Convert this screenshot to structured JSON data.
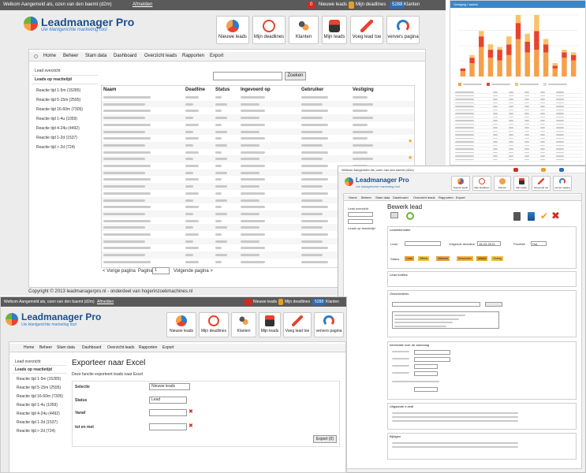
{
  "app": {
    "name": "Leadmanager Pro",
    "tagline": "Uw klantgerichte marketing tool"
  },
  "topbar": {
    "welcome": "Welkom Aangemeld als, ozen van den baemt (d2m)",
    "logout": "Afmelden",
    "new_leads_badge": "0",
    "new_leads": "Nieuwe leads",
    "my_deadlines": "Mijn deadlines",
    "clients_badge": "5288",
    "clients": "Klanten"
  },
  "toolbar": {
    "buttons": [
      {
        "label": "Nieuwe leads",
        "icon": "new-leads-icon"
      },
      {
        "label": "Mijn deadlines",
        "icon": "deadlines-clock-icon"
      },
      {
        "label": "Klanten",
        "icon": "clients-icon"
      },
      {
        "label": "Mijn leads",
        "icon": "my-leads-icon"
      },
      {
        "label": "Voeg lead toe",
        "icon": "add-lead-icon"
      },
      {
        "label": "ververs pagina",
        "icon": "refresh-icon"
      }
    ]
  },
  "tabs": [
    "Home",
    "Beheer",
    "Stam data",
    "Dashboard",
    "Overzicht leads",
    "Rapporten",
    "Export"
  ],
  "sidebar": {
    "overview": "Lead overzicht",
    "by_reaction": "Leads op reactietijd",
    "items": [
      "Reactie tijd 1-5m (15285)",
      "Reactie tijd 5-15m (2595)",
      "Reactie tijd 16-60m (7305)",
      "Reactie tijd 1-4u (1059)",
      "Reactie tijd 4-24u (4492)",
      "Reactie tijd 1-2d (1537)",
      "Reactie tijd > 2d (724)"
    ]
  },
  "search": {
    "button": "Zoeken"
  },
  "table": {
    "headers": [
      "Naam",
      "Deadline",
      "Status",
      "Ingevoerd op",
      "Gebruiker",
      "Vestiging"
    ]
  },
  "pagination": {
    "prev": "< Vorige pagina",
    "page_label": "Pagina",
    "page_value": "1",
    "next": "Volgende pagina >"
  },
  "footer": "Copyright © 2013 leadmanagerpro.nl - onderdeel van hogerinzoekmachines.nl",
  "chart_panel": {
    "title": "Vestiging / aantal",
    "chart_data": {
      "type": "bar",
      "series_colors": [
        "#f5a04a",
        "#e8432e",
        "#f7c36a",
        "#d9d9d9"
      ],
      "stacks": [
        [
          2,
          1,
          0
        ],
        [
          5,
          2,
          1
        ],
        [
          11,
          4,
          2
        ],
        [
          7,
          3,
          2
        ],
        [
          6,
          4,
          1
        ],
        [
          8,
          4,
          3
        ],
        [
          14,
          6,
          3
        ],
        [
          9,
          4,
          3
        ],
        [
          10,
          7,
          6
        ],
        [
          9,
          3,
          2
        ],
        [
          3,
          1,
          1
        ],
        [
          7,
          2,
          1
        ],
        [
          6,
          2,
          1
        ]
      ]
    }
  },
  "edit_lead": {
    "title": "Bewerk lead",
    "sections": {
      "lead": "Leadinformatie",
      "notes": "Lead notities",
      "history": "Geschiedenis",
      "reaction": "Reactie",
      "details": "Informatie over de aanvraag",
      "files": "Uitgaande e-mail",
      "attach": "Bijlagen"
    },
    "fields": {
      "lead": "Lead",
      "deadline_label": "Volgende deadline",
      "deadline_value": "18-03-2013",
      "priority_label": "Prioriteit",
      "priority_value": "Hot",
      "status": "Status",
      "status_tags": [
        "Lead",
        "Offerte",
        "Verloren",
        "Gewonnen",
        "Wacht",
        "Overig"
      ]
    }
  },
  "export": {
    "title": "Exporteer naar Excel",
    "subtitle": "Deze functie exporteert leads naar Excel",
    "selection_label": "Selectie",
    "selection_value": "Nieuwe leads",
    "status_label": "Status",
    "status_value": "Lead",
    "from_label": "Vanaf",
    "to_label": "tot en met",
    "button": "Export (0)"
  }
}
